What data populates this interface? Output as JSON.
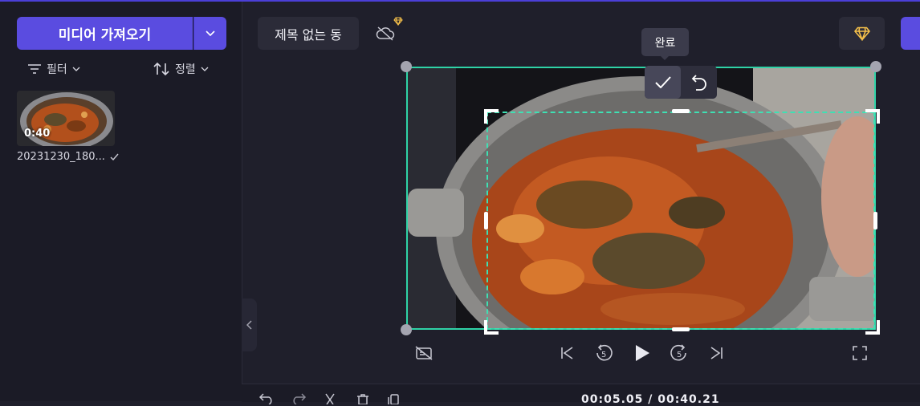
{
  "media_panel": {
    "import_label": "미디어 가져오기",
    "filter_label": "필터",
    "sort_label": "정렬",
    "clip": {
      "duration": "0:40",
      "name": "20231230_180..."
    }
  },
  "header": {
    "project_title": "제목 없는 동"
  },
  "crop": {
    "tooltip": "완료"
  },
  "timeline": {
    "time": "00:05.05 / 00:40.21"
  },
  "colors": {
    "accent": "#5a4ce0",
    "crop_border": "#2fd3a7",
    "premium": "#f5c04a"
  },
  "icons": [
    "chevron-down-icon",
    "filter-icon",
    "sort-icon",
    "check-icon",
    "cloud-off-icon",
    "diamond-icon",
    "undo-icon",
    "captions-off-icon",
    "skip-back-icon",
    "rewind-5-icon",
    "play-icon",
    "forward-5-icon",
    "skip-forward-icon",
    "fullscreen-icon",
    "chevron-left-icon",
    "redo-icon",
    "scissors-icon",
    "trash-icon",
    "copy-icon"
  ]
}
